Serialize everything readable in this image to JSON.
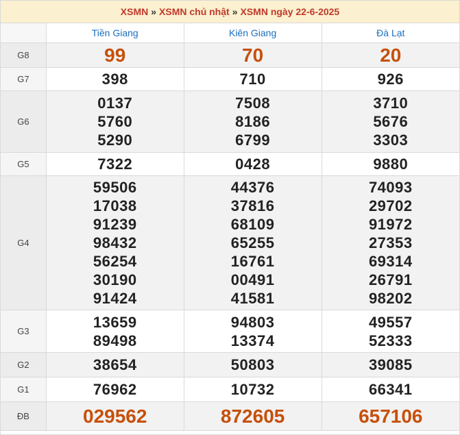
{
  "breadcrumb": {
    "items": [
      "XSMN",
      "XSMN chủ nhật",
      "XSMN ngày 22-6-2025"
    ],
    "separator": "»"
  },
  "provinces": [
    "Tiền Giang",
    "Kiên Giang",
    "Đà Lạt"
  ],
  "prizes": [
    {
      "label": "G8",
      "results": [
        [
          "99"
        ],
        [
          "70"
        ],
        [
          "20"
        ]
      ]
    },
    {
      "label": "G7",
      "results": [
        [
          "398"
        ],
        [
          "710"
        ],
        [
          "926"
        ]
      ]
    },
    {
      "label": "G6",
      "results": [
        [
          "0137",
          "5760",
          "5290"
        ],
        [
          "7508",
          "8186",
          "6799"
        ],
        [
          "3710",
          "5676",
          "3303"
        ]
      ]
    },
    {
      "label": "G5",
      "results": [
        [
          "7322"
        ],
        [
          "0428"
        ],
        [
          "9880"
        ]
      ]
    },
    {
      "label": "G4",
      "results": [
        [
          "59506",
          "17038",
          "91239",
          "98432",
          "56254",
          "30190",
          "91424"
        ],
        [
          "44376",
          "37816",
          "68109",
          "65255",
          "16761",
          "00491",
          "41581"
        ],
        [
          "74093",
          "29702",
          "91972",
          "27353",
          "69314",
          "26791",
          "98202"
        ]
      ]
    },
    {
      "label": "G3",
      "results": [
        [
          "13659",
          "89498"
        ],
        [
          "94803",
          "13374"
        ],
        [
          "49557",
          "52333"
        ]
      ]
    },
    {
      "label": "G2",
      "results": [
        [
          "38654"
        ],
        [
          "50803"
        ],
        [
          "39085"
        ]
      ]
    },
    {
      "label": "G1",
      "results": [
        [
          "76962"
        ],
        [
          "10732"
        ],
        [
          "66341"
        ]
      ]
    },
    {
      "label": "ĐB",
      "results": [
        [
          "029562"
        ],
        [
          "872605"
        ],
        [
          "657106"
        ]
      ]
    }
  ],
  "colors": {
    "accent": "#c6500b",
    "header_bg": "#fbf0cf",
    "link": "#1a6fc0",
    "breadcrumb": "#c0392b"
  }
}
